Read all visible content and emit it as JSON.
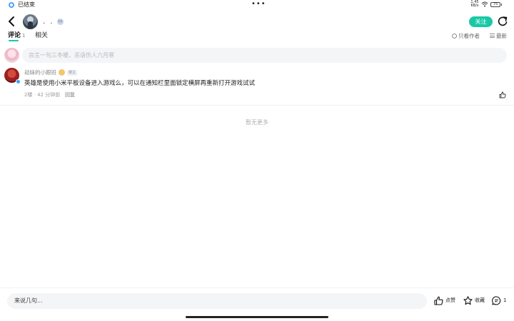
{
  "status_bar": {
    "label": "已结束",
    "dots": "•••",
    "network": "1.45\nKB/s",
    "battery": "75"
  },
  "header": {
    "user_name": ". .",
    "user_level": "Lv",
    "follow_label": "关注"
  },
  "tabs": {
    "comments": "评论",
    "comments_badge": "1",
    "related": "相关",
    "filter_author": "只看作者",
    "filter_latest": "最新"
  },
  "comment_input": {
    "placeholder": "良言一句三冬暖，恶语伤人六月寒"
  },
  "comments": [
    {
      "author": "劫妹的小跟班",
      "tag": "楼主",
      "text": "英雄是使用小米平板设备进入游戏么，可以在通知栏里面锁定横屏再重新打开游戏试试",
      "meta": "2楼 · 42 分钟前",
      "reply_label": "回复"
    }
  ],
  "no_more": "暂无更多",
  "bottom_bar": {
    "input_placeholder": "来说几句...",
    "like_label": "点赞",
    "fav_label": "收藏",
    "comment_count": "1"
  },
  "colors": {
    "accent": "#19c9a5"
  }
}
